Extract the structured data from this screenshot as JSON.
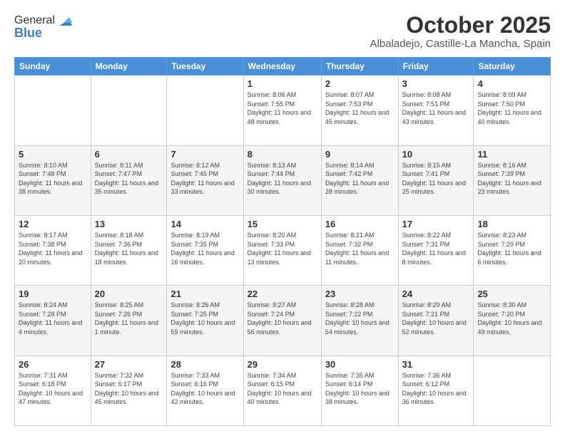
{
  "header": {
    "logo_general": "General",
    "logo_blue": "Blue",
    "month": "October 2025",
    "location": "Albaladejo, Castille-La Mancha, Spain"
  },
  "days_of_week": [
    "Sunday",
    "Monday",
    "Tuesday",
    "Wednesday",
    "Thursday",
    "Friday",
    "Saturday"
  ],
  "weeks": [
    [
      {
        "day": "",
        "info": ""
      },
      {
        "day": "",
        "info": ""
      },
      {
        "day": "",
        "info": ""
      },
      {
        "day": "1",
        "info": "Sunrise: 8:06 AM\nSunset: 7:55 PM\nDaylight: 11 hours and 48 minutes."
      },
      {
        "day": "2",
        "info": "Sunrise: 8:07 AM\nSunset: 7:53 PM\nDaylight: 11 hours and 45 minutes."
      },
      {
        "day": "3",
        "info": "Sunrise: 8:08 AM\nSunset: 7:51 PM\nDaylight: 11 hours and 43 minutes."
      },
      {
        "day": "4",
        "info": "Sunrise: 8:09 AM\nSunset: 7:50 PM\nDaylight: 11 hours and 40 minutes."
      }
    ],
    [
      {
        "day": "5",
        "info": "Sunrise: 8:10 AM\nSunset: 7:48 PM\nDaylight: 11 hours and 38 minutes."
      },
      {
        "day": "6",
        "info": "Sunrise: 8:11 AM\nSunset: 7:47 PM\nDaylight: 11 hours and 35 minutes."
      },
      {
        "day": "7",
        "info": "Sunrise: 8:12 AM\nSunset: 7:45 PM\nDaylight: 11 hours and 33 minutes."
      },
      {
        "day": "8",
        "info": "Sunrise: 8:13 AM\nSunset: 7:44 PM\nDaylight: 11 hours and 30 minutes."
      },
      {
        "day": "9",
        "info": "Sunrise: 8:14 AM\nSunset: 7:42 PM\nDaylight: 11 hours and 28 minutes."
      },
      {
        "day": "10",
        "info": "Sunrise: 8:15 AM\nSunset: 7:41 PM\nDaylight: 11 hours and 25 minutes."
      },
      {
        "day": "11",
        "info": "Sunrise: 8:16 AM\nSunset: 7:39 PM\nDaylight: 11 hours and 23 minutes."
      }
    ],
    [
      {
        "day": "12",
        "info": "Sunrise: 8:17 AM\nSunset: 7:38 PM\nDaylight: 11 hours and 20 minutes."
      },
      {
        "day": "13",
        "info": "Sunrise: 8:18 AM\nSunset: 7:36 PM\nDaylight: 11 hours and 18 minutes."
      },
      {
        "day": "14",
        "info": "Sunrise: 8:19 AM\nSunset: 7:35 PM\nDaylight: 11 hours and 16 minutes."
      },
      {
        "day": "15",
        "info": "Sunrise: 8:20 AM\nSunset: 7:33 PM\nDaylight: 11 hours and 13 minutes."
      },
      {
        "day": "16",
        "info": "Sunrise: 8:21 AM\nSunset: 7:32 PM\nDaylight: 11 hours and 11 minutes."
      },
      {
        "day": "17",
        "info": "Sunrise: 8:22 AM\nSunset: 7:31 PM\nDaylight: 11 hours and 8 minutes."
      },
      {
        "day": "18",
        "info": "Sunrise: 8:23 AM\nSunset: 7:29 PM\nDaylight: 11 hours and 6 minutes."
      }
    ],
    [
      {
        "day": "19",
        "info": "Sunrise: 8:24 AM\nSunset: 7:28 PM\nDaylight: 11 hours and 4 minutes."
      },
      {
        "day": "20",
        "info": "Sunrise: 8:25 AM\nSunset: 7:26 PM\nDaylight: 11 hours and 1 minute."
      },
      {
        "day": "21",
        "info": "Sunrise: 8:26 AM\nSunset: 7:25 PM\nDaylight: 10 hours and 59 minutes."
      },
      {
        "day": "22",
        "info": "Sunrise: 8:27 AM\nSunset: 7:24 PM\nDaylight: 10 hours and 56 minutes."
      },
      {
        "day": "23",
        "info": "Sunrise: 8:28 AM\nSunset: 7:22 PM\nDaylight: 10 hours and 54 minutes."
      },
      {
        "day": "24",
        "info": "Sunrise: 8:29 AM\nSunset: 7:21 PM\nDaylight: 10 hours and 52 minutes."
      },
      {
        "day": "25",
        "info": "Sunrise: 8:30 AM\nSunset: 7:20 PM\nDaylight: 10 hours and 49 minutes."
      }
    ],
    [
      {
        "day": "26",
        "info": "Sunrise: 7:31 AM\nSunset: 6:18 PM\nDaylight: 10 hours and 47 minutes."
      },
      {
        "day": "27",
        "info": "Sunrise: 7:32 AM\nSunset: 6:17 PM\nDaylight: 10 hours and 45 minutes."
      },
      {
        "day": "28",
        "info": "Sunrise: 7:33 AM\nSunset: 6:16 PM\nDaylight: 10 hours and 42 minutes."
      },
      {
        "day": "29",
        "info": "Sunrise: 7:34 AM\nSunset: 6:15 PM\nDaylight: 10 hours and 40 minutes."
      },
      {
        "day": "30",
        "info": "Sunrise: 7:35 AM\nSunset: 6:14 PM\nDaylight: 10 hours and 38 minutes."
      },
      {
        "day": "31",
        "info": "Sunrise: 7:36 AM\nSunset: 6:12 PM\nDaylight: 10 hours and 36 minutes."
      },
      {
        "day": "",
        "info": ""
      }
    ]
  ]
}
